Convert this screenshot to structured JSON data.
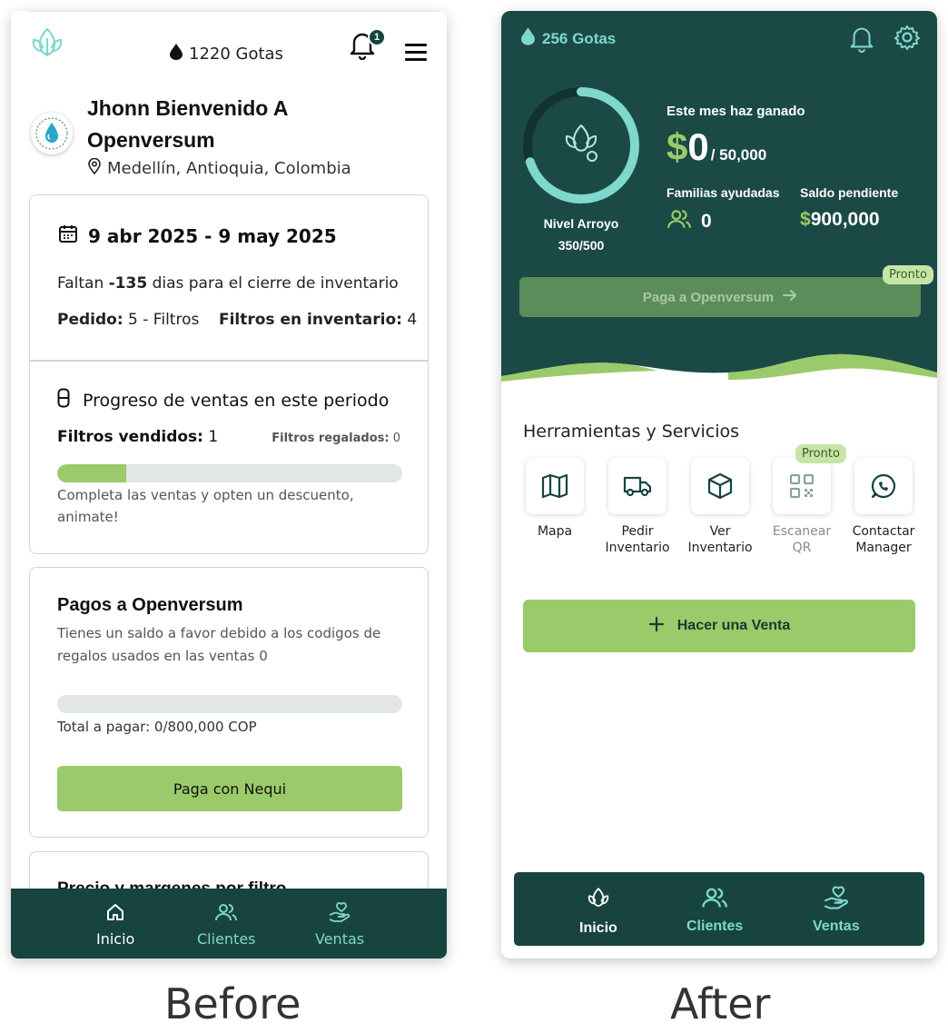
{
  "captions": {
    "before": "Before",
    "after": "After"
  },
  "before": {
    "header": {
      "gotas": "1220 Gotas",
      "notification_count": "1"
    },
    "profile": {
      "welcome": "Jhonn Bienvenido A Openversum",
      "location": "Medellín, Antioquia, Colombia"
    },
    "period": {
      "date_range": "9 abr 2025 - 9 may 2025",
      "faltan_prefix": "Faltan ",
      "faltan_days": "-135",
      "faltan_suffix": " dias para el cierre de inventario",
      "pedido_label": "Pedido:",
      "pedido_value": " 5 - Filtros",
      "inventario_label": "Filtros en inventario:",
      "inventario_value": " 4"
    },
    "progress": {
      "title": "Progreso de ventas en este periodo",
      "vendidos_label": "Filtros vendidos:",
      "vendidos_value": " 1",
      "regalados_label": "Filtros regalados:",
      "regalados_value": " 0",
      "progress_fraction": 0.2,
      "hint": "Completa las ventas y opten un descuento, animate!"
    },
    "pagos": {
      "title": "Pagos a Openversum",
      "description": "Tienes un saldo a favor debido a los codigos de regalos usados en las ventas 0",
      "progress_fraction": 0.0,
      "total": "Total a pagar: 0/800,000 COP",
      "button": "Paga con Nequi"
    },
    "precio": {
      "title": "Precio y margenes por filtro"
    },
    "nav": [
      {
        "label": "Inicio",
        "icon": "home-icon",
        "active": true
      },
      {
        "label": "Clientes",
        "icon": "users-icon",
        "active": false
      },
      {
        "label": "Ventas",
        "icon": "hand-heart-icon",
        "active": false
      }
    ]
  },
  "after": {
    "header": {
      "gotas": "256 Gotas"
    },
    "level": {
      "name": "Nivel Arroyo",
      "points": "350/500",
      "progress_fraction": 0.7
    },
    "earnings": {
      "label": "Este mes haz ganado",
      "currency": "$",
      "amount": "0",
      "goal": "/ 50,000"
    },
    "familias": {
      "label": "Familias ayudadas",
      "value": "0"
    },
    "saldo": {
      "label": "Saldo pendiente",
      "currency": "$",
      "value": "900,000"
    },
    "paga_button": {
      "label": "Paga a Openversum",
      "badge": "Pronto"
    },
    "tools": {
      "title": "Herramientas y Servicios",
      "badge": "Pronto",
      "items": [
        {
          "line1": "Mapa",
          "line2": "",
          "icon": "map-icon"
        },
        {
          "line1": "Pedir",
          "line2": "Inventario",
          "icon": "truck-icon"
        },
        {
          "line1": "Ver",
          "line2": "Inventario",
          "icon": "box-icon"
        },
        {
          "line1": "Escanear",
          "line2": "QR",
          "icon": "qr-icon"
        },
        {
          "line1": "Contactar",
          "line2": "Manager",
          "icon": "whatsapp-icon"
        }
      ]
    },
    "venta_button": "Hacer una Venta",
    "nav": [
      {
        "label": "Inicio",
        "icon": "leaf-logo-icon",
        "active": true
      },
      {
        "label": "Clientes",
        "icon": "users-icon",
        "active": false
      },
      {
        "label": "Ventas",
        "icon": "hand-heart-icon",
        "active": false
      }
    ]
  },
  "colors": {
    "dark_teal": "#17443f",
    "hero_teal": "#1b4a46",
    "accent_green": "#9bca6a",
    "accent_cyan": "#7fd8cc"
  }
}
